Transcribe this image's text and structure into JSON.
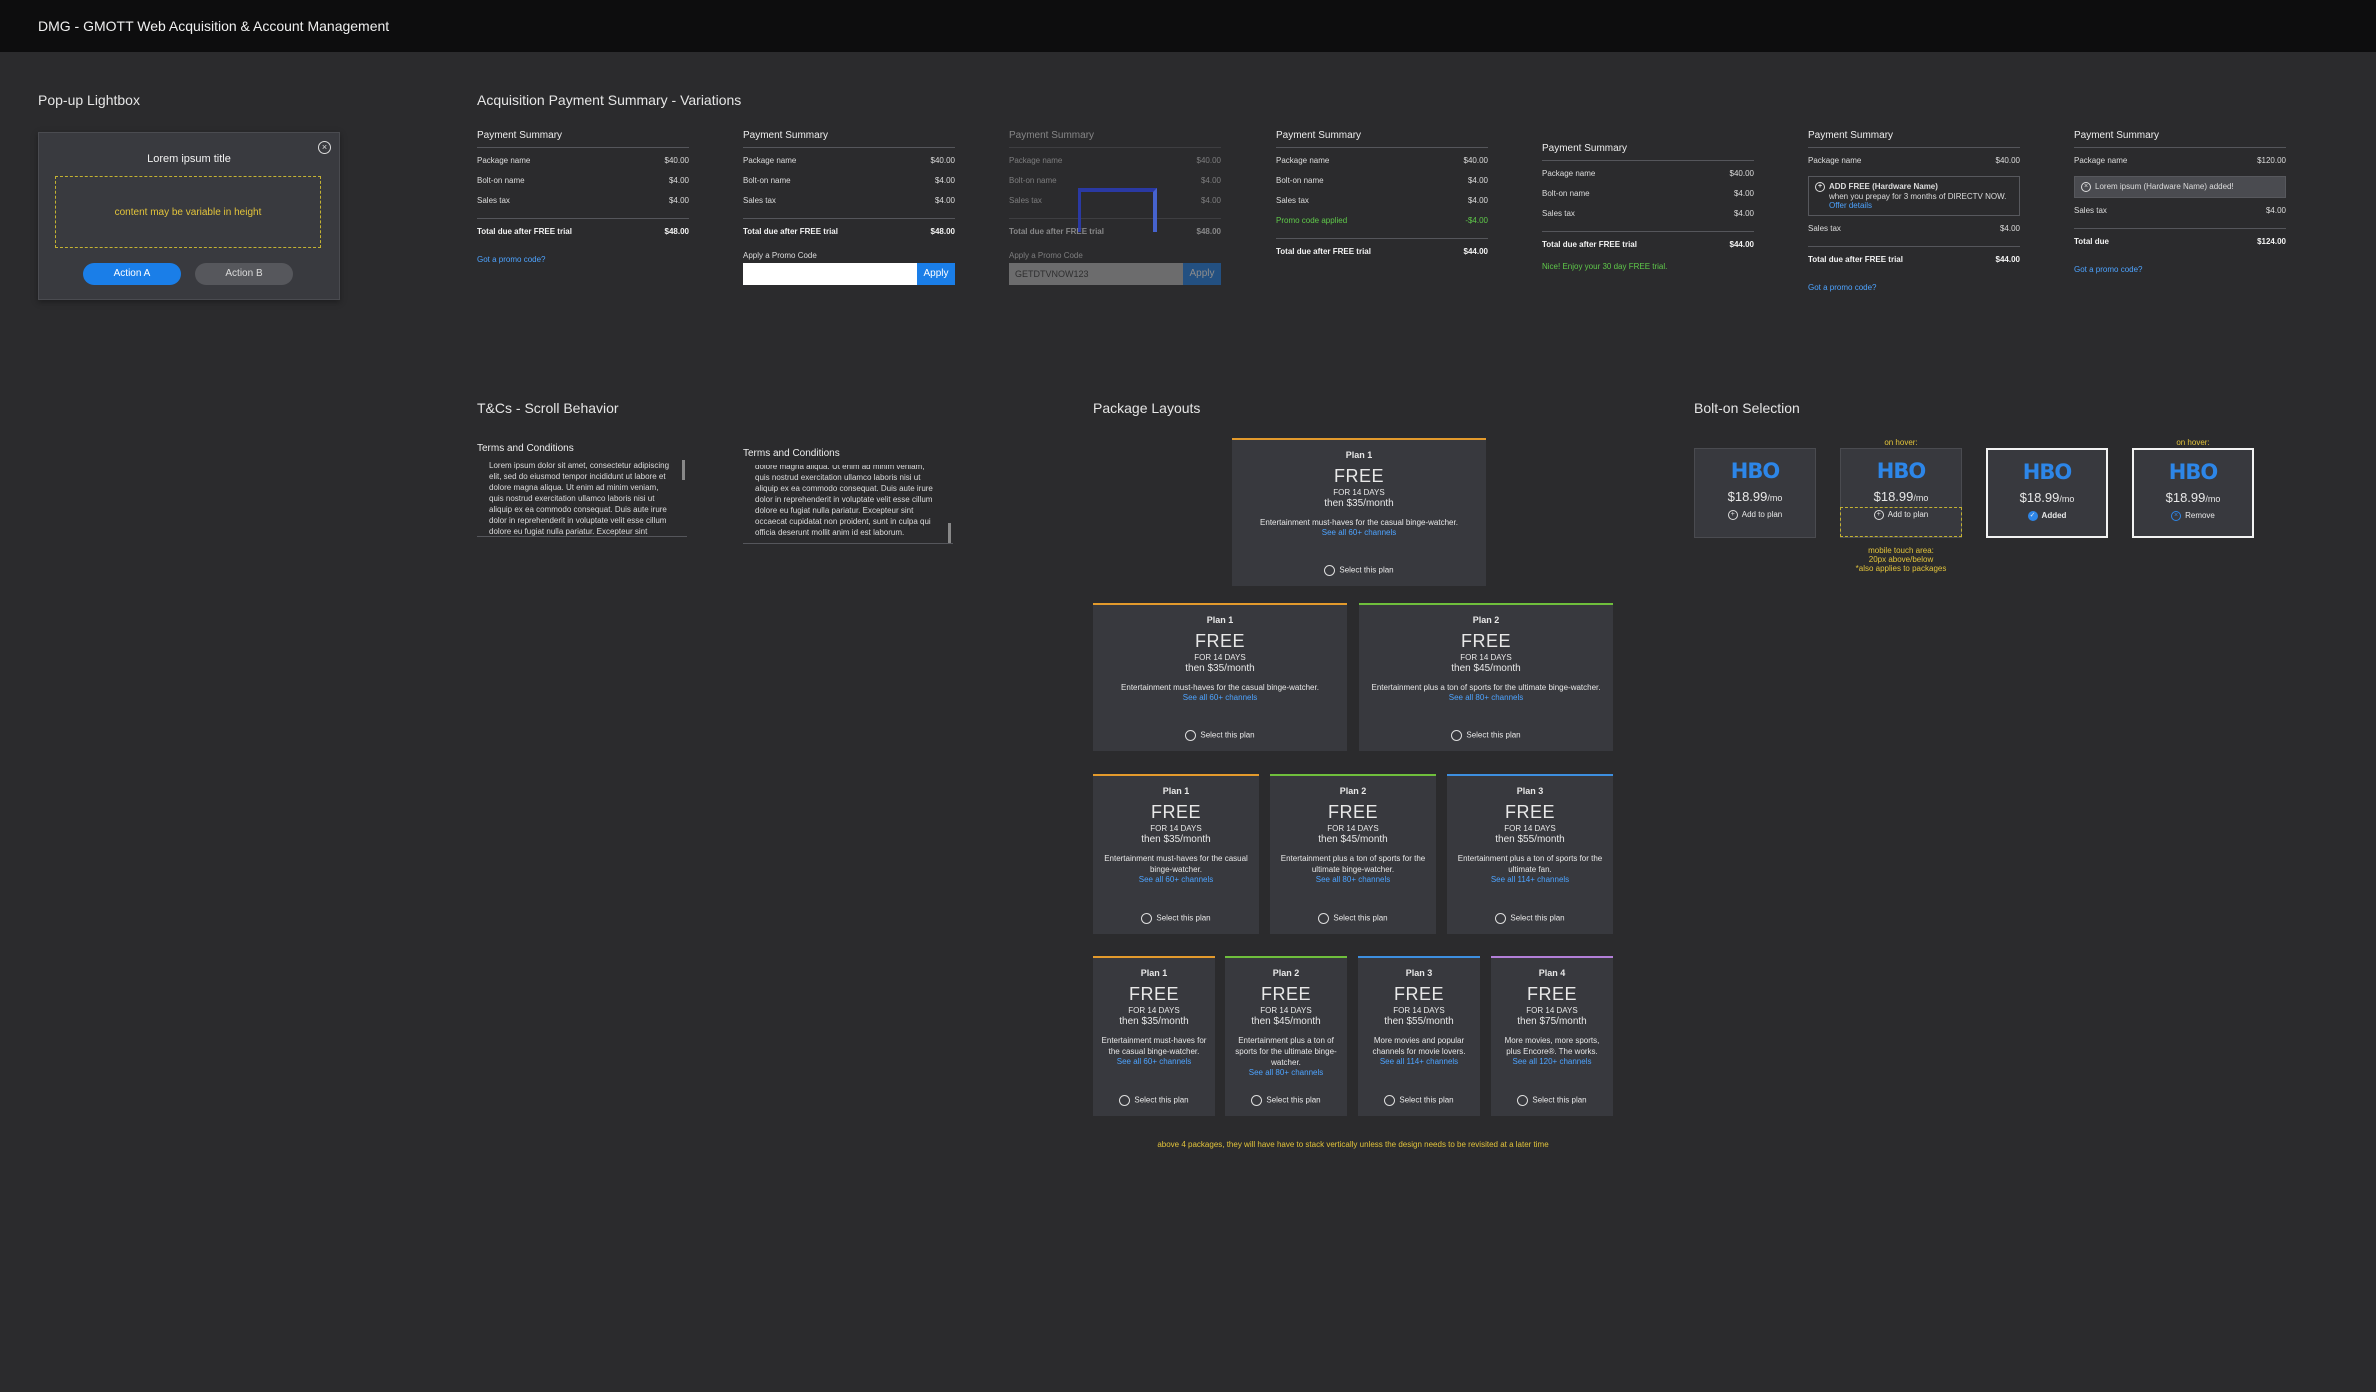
{
  "app_title": "DMG - GMOTT Web Acquisition & Account Management",
  "sections": {
    "lightbox": "Pop-up Lightbox",
    "payment": "Acquisition Payment Summary - Variations",
    "tc": "T&Cs - Scroll Behavior",
    "packages": "Package Layouts",
    "bolton": "Bolt-on Selection"
  },
  "lightbox": {
    "title": "Lorem ipsum title",
    "content": "content may be variable in height",
    "action_a": "Action A",
    "action_b": "Action B",
    "close": "×"
  },
  "ps": {
    "title": "Payment Summary",
    "package": "Package name",
    "bolton": "Bolt-on name",
    "tax": "Sales tax",
    "total_trial": "Total due after FREE trial",
    "total": "Total due",
    "promo_link": "Got a promo code?",
    "apply_label": "Apply a Promo Code",
    "apply": "Apply",
    "promo_value": "GETDTVNOW123",
    "promo_applied": "Promo code applied",
    "enjoy": "Nice! Enjoy your 30 day FREE trial.",
    "bolt_free": "ADD FREE (Hardware Name)",
    "bolt_desc": "when you prepay for 3 months of DIRECTV NOW.",
    "offer": "Offer details",
    "lorem_added": "Lorem ipsum (Hardware Name) added!",
    "v40": "$40.00",
    "v4": "$4.00",
    "v48": "$48.00",
    "v44": "$44.00",
    "vm4": "-$4.00",
    "v120": "$120.00",
    "v124": "$124.00"
  },
  "tc": {
    "title": "Terms and Conditions",
    "body1": "Lorem ipsum dolor sit amet, consectetur adipiscing elit, sed do eiusmod tempor incididunt ut labore et dolore magna aliqua. Ut enim ad minim veniam, quis nostrud exercitation ullamco laboris nisi ut aliquip ex ea commodo consequat. Duis aute irure dolor in reprehenderit in voluptate velit esse cillum dolore eu fugiat nulla pariatur. Excepteur sint occaecat cupidatat non proident, sunt in culpa qui officia deserunt mollit anim id est laborum.",
    "body2": "dolore magna aliqua. Ut enim ad minim veniam, quis nostrud exercitation ullamco laboris nisi ut aliquip ex ea commodo consequat. Duis aute irure dolor in reprehenderit in voluptate velit esse cillum dolore eu fugiat nulla pariatur. Excepteur sint occaecat cupidatat non proident, sunt in culpa qui officia deserunt mollit anim id est laborum."
  },
  "plan": {
    "free": "FREE",
    "days": "FOR 14 DAYS",
    "select": "Select this plan",
    "p1": "Plan 1",
    "p2": "Plan 2",
    "p3": "Plan 3",
    "p4": "Plan 4",
    "then35": "then $35/month",
    "then45": "then $45/month",
    "then55": "then $55/month",
    "then75": "then $75/month",
    "d1": "Entertainment must-haves for the casual binge-watcher.",
    "d2": "Entertainment plus a ton of sports for the ultimate binge-watcher.",
    "d3": "Entertainment plus a ton of sports for the ultimate fan.",
    "d3b": "More movies and popular channels for movie lovers.",
    "d4": "More movies, more sports, plus Encore®. The works.",
    "see60": "See all 60+ channels",
    "see80": "See all 80+ channels",
    "see114": "See all 114+ channels",
    "see120": "See all 120+ channels",
    "note": "above 4 packages, they will have have to stack vertically unless the design needs to be revisited at a later time",
    "colors": {
      "p1": "#e39a2c",
      "p2": "#6fbf3c",
      "p3": "#3d8fe0",
      "p4": "#b37fd8"
    }
  },
  "bolton": {
    "logo": "HBO",
    "price": "$18.99",
    "per": "/mo",
    "add": "Add to plan",
    "added": "Added",
    "remove": "Remove",
    "on_hover": "on hover:",
    "touch_note1": "mobile touch area:",
    "touch_note2": "20px above/below",
    "touch_note3": "*also applies to packages"
  }
}
